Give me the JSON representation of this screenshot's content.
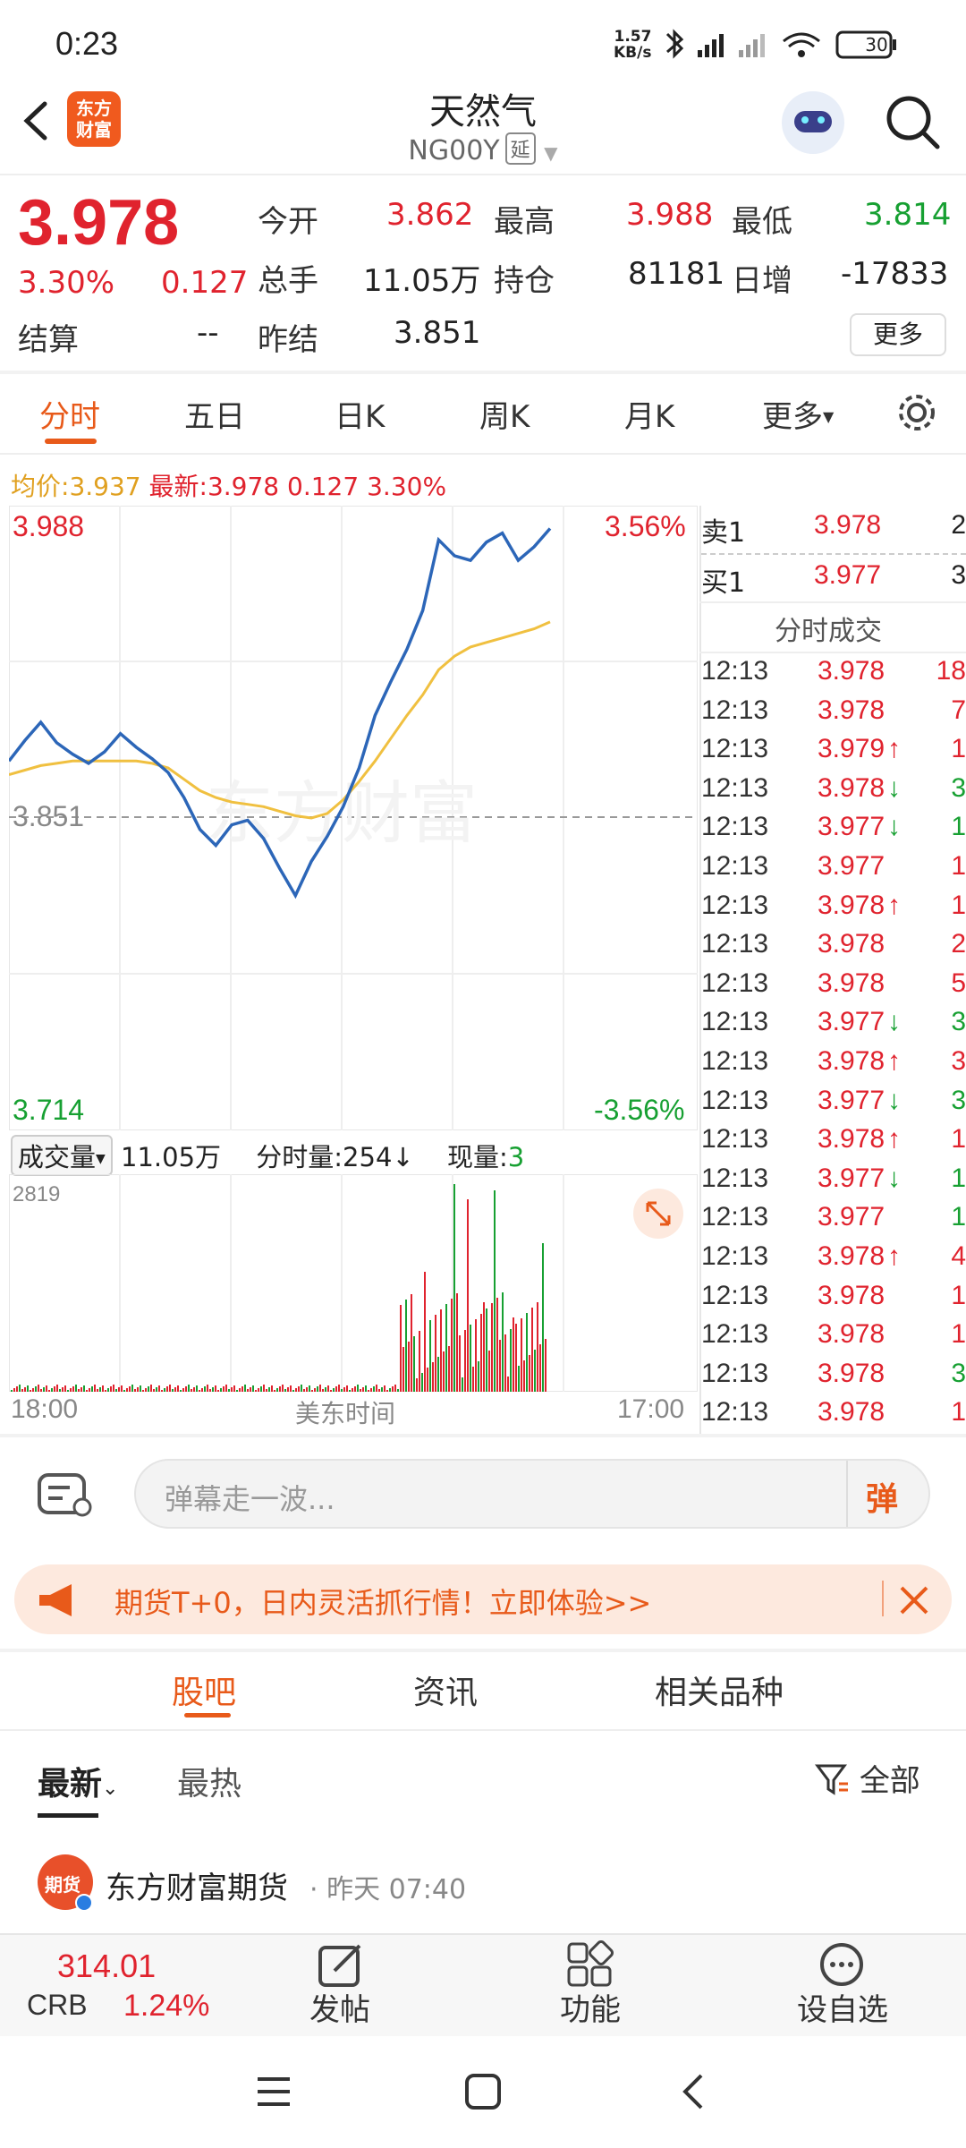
{
  "status_bar": {
    "time": "0:23",
    "net_speed": "1.57",
    "net_unit": "KB/s",
    "battery": "30"
  },
  "header": {
    "title": "天然气",
    "code": "NG00Y",
    "delay_badge": "延",
    "logo_text_1": "东方",
    "logo_text_2": "财富"
  },
  "quote": {
    "price": "3.978",
    "change_pct": "3.30%",
    "change": "0.127",
    "open_label": "今开",
    "open": "3.862",
    "high_label": "最高",
    "high": "3.988",
    "low_label": "最低",
    "low": "3.814",
    "volume_label": "总手",
    "volume": "11.05万",
    "oi_label": "持仓",
    "oi": "81181",
    "daily_inc_label": "日增",
    "daily_inc": "-17833",
    "settle_label": "结算",
    "settle": "--",
    "prev_settle_label": "昨结",
    "prev_settle": "3.851",
    "more_button": "更多"
  },
  "tabs": [
    "分时",
    "五日",
    "日K",
    "周K",
    "月K",
    "更多"
  ],
  "info_line": {
    "avg_label": "均价:",
    "avg": "3.937",
    "latest_label": "最新:",
    "latest": "3.978",
    "change": "0.127",
    "pct": "3.30%"
  },
  "chart": {
    "top_price": "3.988",
    "top_pct": "3.56%",
    "mid_price": "3.851",
    "bottom_price": "3.714",
    "bottom_pct": "-3.56%",
    "x_start": "18:00",
    "x_mid": "美东时间",
    "x_end": "17:00",
    "watermark": "东方财富",
    "vol_label": "成交量",
    "vol_value": "11.05万",
    "tick_vol_label": "分时量:",
    "tick_vol": "254",
    "cur_vol_label": "现量:",
    "cur_vol": "3",
    "vol_max": "2819"
  },
  "chart_data": {
    "type": "line",
    "ylim": [
      3.714,
      3.988
    ],
    "series": [
      {
        "values": [
          3.876,
          3.885,
          3.893,
          3.884,
          3.879,
          3.875,
          3.88,
          3.888,
          3.882,
          3.877,
          3.871,
          3.86,
          3.846,
          3.839,
          3.848,
          3.85,
          3.842,
          3.829,
          3.817,
          3.832,
          3.843,
          3.856,
          3.873,
          3.896,
          3.911,
          3.925,
          3.942,
          3.973,
          3.966,
          3.964,
          3.972,
          3.976,
          3.964,
          3.97,
          3.978
        ]
      },
      {
        "values": [
          3.87,
          3.872,
          3.874,
          3.875,
          3.876,
          3.876,
          3.876,
          3.876,
          3.876,
          3.875,
          3.873,
          3.868,
          3.863,
          3.86,
          3.858,
          3.857,
          3.856,
          3.854,
          3.852,
          3.851,
          3.853,
          3.859,
          3.867,
          3.876,
          3.886,
          3.896,
          3.905,
          3.916,
          3.922,
          3.926,
          3.928,
          3.93,
          3.932,
          3.934,
          3.937
        ]
      }
    ]
  },
  "orderbook": {
    "sell_label": "卖1",
    "sell_price": "3.978",
    "sell_qty": "2",
    "buy_label": "买1",
    "buy_price": "3.977",
    "buy_qty": "3",
    "ticks_title": "分时成交"
  },
  "trades": [
    {
      "t": "12:13",
      "p": "3.978",
      "a": "",
      "q": "18",
      "qc": "red"
    },
    {
      "t": "12:13",
      "p": "3.978",
      "a": "",
      "q": "7",
      "qc": "red"
    },
    {
      "t": "12:13",
      "p": "3.979",
      "a": "↑",
      "q": "1",
      "qc": "red"
    },
    {
      "t": "12:13",
      "p": "3.978",
      "a": "↓",
      "q": "3",
      "qc": "green"
    },
    {
      "t": "12:13",
      "p": "3.977",
      "a": "↓",
      "q": "1",
      "qc": "green"
    },
    {
      "t": "12:13",
      "p": "3.977",
      "a": "",
      "q": "1",
      "qc": "red"
    },
    {
      "t": "12:13",
      "p": "3.978",
      "a": "↑",
      "q": "1",
      "qc": "red"
    },
    {
      "t": "12:13",
      "p": "3.978",
      "a": "",
      "q": "2",
      "qc": "red"
    },
    {
      "t": "12:13",
      "p": "3.978",
      "a": "",
      "q": "5",
      "qc": "red"
    },
    {
      "t": "12:13",
      "p": "3.977",
      "a": "↓",
      "q": "3",
      "qc": "green"
    },
    {
      "t": "12:13",
      "p": "3.978",
      "a": "↑",
      "q": "3",
      "qc": "red"
    },
    {
      "t": "12:13",
      "p": "3.977",
      "a": "↓",
      "q": "3",
      "qc": "green"
    },
    {
      "t": "12:13",
      "p": "3.978",
      "a": "↑",
      "q": "1",
      "qc": "red"
    },
    {
      "t": "12:13",
      "p": "3.977",
      "a": "↓",
      "q": "1",
      "qc": "green"
    },
    {
      "t": "12:13",
      "p": "3.977",
      "a": "",
      "q": "1",
      "qc": "green"
    },
    {
      "t": "12:13",
      "p": "3.978",
      "a": "↑",
      "q": "4",
      "qc": "red"
    },
    {
      "t": "12:13",
      "p": "3.978",
      "a": "",
      "q": "1",
      "qc": "red"
    },
    {
      "t": "12:13",
      "p": "3.978",
      "a": "",
      "q": "1",
      "qc": "red"
    },
    {
      "t": "12:13",
      "p": "3.978",
      "a": "",
      "q": "3",
      "qc": "green"
    },
    {
      "t": "12:13",
      "p": "3.978",
      "a": "",
      "q": "1",
      "qc": "red"
    }
  ],
  "danmu": {
    "placeholder": "弹幕走一波...",
    "send": "弹"
  },
  "promo": {
    "text": "期货T+0，日内灵活抓行情！立即体验>>"
  },
  "section_tabs": [
    "股吧",
    "资讯",
    "相关品种"
  ],
  "feed": {
    "sort_latest": "最新",
    "sort_hot": "最热",
    "filter": "全部",
    "post_author": "东方财富期货",
    "post_time": "昨天 07:40",
    "avatar_text": "期货"
  },
  "bottom_bar": {
    "index_value": "314.01",
    "index_name": "CRB",
    "index_pct": "1.24%",
    "post": "发帖",
    "functions": "功能",
    "watchlist": "设自选"
  },
  "colors": {
    "up": "#e0232e",
    "down": "#17a032",
    "accent": "#e85a1a",
    "price_line": "#2c66b8",
    "avg_line": "#f0c040"
  }
}
